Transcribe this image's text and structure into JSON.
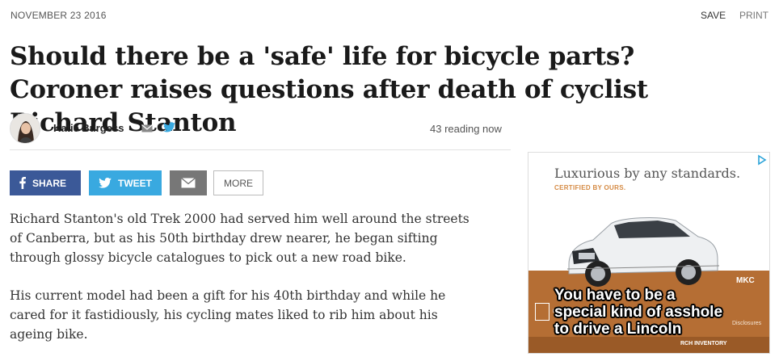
{
  "header": {
    "date": "NOVEMBER 23 2016",
    "save_label": "SAVE",
    "print_label": "PRINT"
  },
  "article": {
    "headline": "Should there be a 'safe' life for bicycle parts? Coroner raises questions after death of cyclist Richard Stanton",
    "author": "Katie Burgess",
    "reading_now": "43 reading now",
    "paragraphs": [
      "Richard Stanton's old Trek 2000 had served him well around the streets of Canberra, but as his 50th birthday drew nearer, he began sifting through glossy bicycle catalogues to pick out a new road bike.",
      "His current model had been a gift for his 40th birthday and while he cared for it fastidiously, his cycling mates liked to rib him about his ageing bike."
    ]
  },
  "share": {
    "facebook_label": "SHARE",
    "twitter_label": "TWEET",
    "more_label": "MORE"
  },
  "ad": {
    "headline": "Luxurious by any standards.",
    "subheadline": "CERTIFIED BY OURS.",
    "model": "MKC",
    "brand": "LINCOLN",
    "disclosures": "Disclosures",
    "inventory": "RCH INVENTORY",
    "meme_lines": [
      "You have to be a",
      "special kind of asshole",
      "to drive a Lincoln"
    ]
  },
  "icons": {
    "mail": "mail-icon",
    "twitter": "twitter-icon",
    "facebook": "facebook-icon",
    "ad_choices": "adchoices-icon"
  },
  "colors": {
    "facebook": "#3b5998",
    "twitter": "#39a9e0",
    "mail_button": "#777777",
    "ad_copper": "#b56e34",
    "ad_tagline": "#d58a43"
  }
}
